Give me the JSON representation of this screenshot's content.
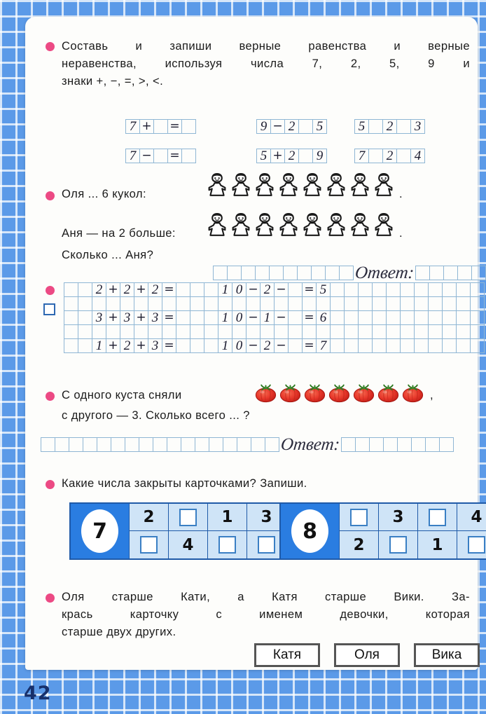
{
  "page": {
    "number": "42"
  },
  "tasks": {
    "t1": {
      "lines": [
        [
          "Составь",
          "и",
          "запиши",
          "верные",
          "равенства",
          "и",
          "верные"
        ],
        [
          "неравенства,",
          "используя",
          "числа",
          "7,",
          "2,",
          "5,",
          "9",
          "и"
        ],
        [
          "знаки +, −, =, >, <."
        ]
      ],
      "groups": [
        {
          "name": "group-1",
          "rows": [
            {
              "cells": [
                "7",
                "+",
                "",
                "=",
                ""
              ]
            },
            {
              "cells": [
                "7",
                "−",
                "",
                "=",
                ""
              ]
            }
          ]
        },
        {
          "name": "group-2",
          "rows": [
            {
              "cells": [
                "9",
                "−",
                "2",
                "",
                "5"
              ]
            },
            {
              "cells": [
                "5",
                "+",
                "2",
                "",
                "9"
              ]
            }
          ]
        },
        {
          "name": "group-3",
          "rows": [
            {
              "cells": [
                "5",
                "",
                "2",
                "",
                "3"
              ]
            },
            {
              "cells": [
                "7",
                "",
                "2",
                "",
                "4"
              ]
            }
          ]
        }
      ]
    },
    "t2": {
      "line1": "Оля ... 6 кукол:",
      "line2": "Аня — на 2 больше:",
      "line3": "Сколько ... Аня?",
      "dolls_row1": 8,
      "dolls_row2": 8,
      "answer_label": "Ответ:",
      "cells_before": 10,
      "cells_after": 5
    },
    "t3": {
      "left_rows": [
        [
          "",
          "2",
          "+",
          "2",
          "+",
          "2",
          "=",
          "",
          "",
          ""
        ],
        [
          "",
          "3",
          "+",
          "3",
          "+",
          "3",
          "=",
          "",
          "",
          ""
        ],
        [
          "",
          "1",
          "+",
          "2",
          "+",
          "3",
          "=",
          "",
          "",
          ""
        ]
      ],
      "right_rows": [
        [
          "1",
          "0",
          "−",
          "2",
          "−",
          "",
          "=",
          "5"
        ],
        [
          "1",
          "0",
          "−",
          "1",
          "−",
          "",
          "=",
          "6"
        ],
        [
          "1",
          "0",
          "−",
          "2",
          "−",
          "",
          "=",
          "7"
        ]
      ],
      "total_cols": 30,
      "total_rows": 5
    },
    "t4": {
      "line1_pre": "С одного куста сняли",
      "line1_post": ",",
      "line2": "с другого — 3. Сколько всего ... ?",
      "tomatoes": 7,
      "answer_label": "Ответ:",
      "cells_before": 17,
      "cells_after": 8
    },
    "t5": {
      "prompt": "Какие числа закрыты карточками? Запиши.",
      "cards": [
        {
          "key": "7",
          "top": [
            "2",
            "",
            "1",
            "3"
          ],
          "bottom": [
            "",
            "4",
            "",
            ""
          ]
        },
        {
          "key": "8",
          "top": [
            "",
            "3",
            "",
            "4"
          ],
          "bottom": [
            "2",
            "",
            "1",
            ""
          ]
        }
      ]
    },
    "t6": {
      "lines": [
        [
          "Оля",
          "старше",
          "Кати,",
          "а",
          "Катя",
          "старше",
          "Вики.",
          "За-"
        ],
        [
          "крась",
          "карточку",
          "с",
          "именем",
          "девочки,",
          "которая"
        ],
        [
          "старше двух других."
        ]
      ],
      "names": [
        "Катя",
        "Оля",
        "Вика"
      ]
    }
  },
  "colors": {
    "bg_blue": "#5b9ae8",
    "bullet_pink": "#ec4a84",
    "card_blue": "#2a7de1",
    "card_light": "#cfe4f7",
    "grid_line": "#8fb6d4",
    "tomato_red": "#e8392c",
    "page_num": "#17306b"
  }
}
